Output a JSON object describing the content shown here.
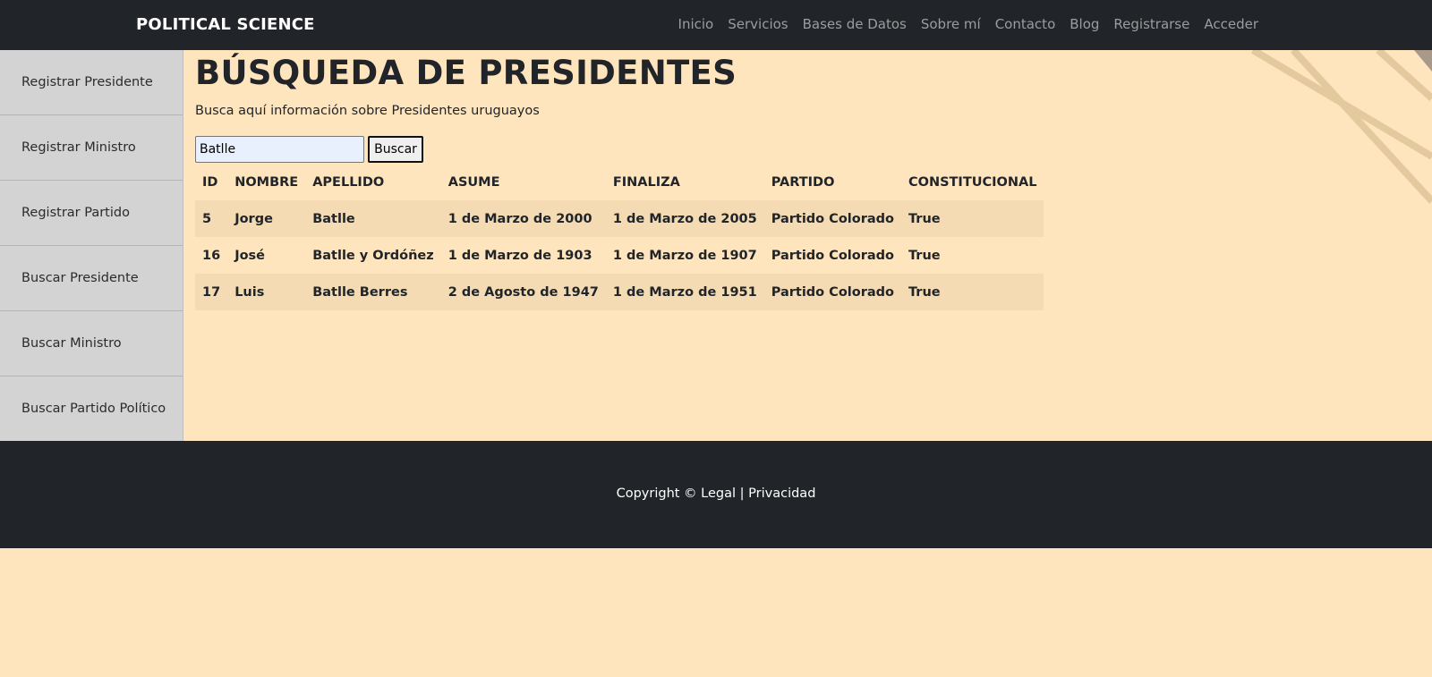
{
  "navbar": {
    "brand": "POLITICAL SCIENCE",
    "links": [
      "Inicio",
      "Servicios",
      "Bases de Datos",
      "Sobre mí",
      "Contacto",
      "Blog",
      "Registrarse",
      "Acceder"
    ]
  },
  "sidebar": {
    "items": [
      {
        "label": "Registrar Presidente"
      },
      {
        "label": "Registrar Ministro"
      },
      {
        "label": "Registrar Partido"
      },
      {
        "label": "Buscar Presidente"
      },
      {
        "label": "Buscar Ministro"
      },
      {
        "label": "Buscar Partido Político"
      }
    ]
  },
  "main": {
    "title": "BÚSQUEDA DE PRESIDENTES",
    "subtitle": "Busca aquí información sobre Presidentes uruguayos",
    "search": {
      "value": "Batlle",
      "button_label": "Buscar"
    },
    "table": {
      "headers": [
        "ID",
        "NOMBRE",
        "APELLIDO",
        "ASUME",
        "FINALIZA",
        "PARTIDO",
        "CONSTITUCIONAL"
      ],
      "rows": [
        [
          "5",
          "Jorge",
          "Batlle",
          "1 de Marzo de 2000",
          "1 de Marzo de 2005",
          "Partido Colorado",
          "True"
        ],
        [
          "16",
          "José",
          "Batlle y Ordóñez",
          "1 de Marzo de 1903",
          "1 de Marzo de 1907",
          "Partido Colorado",
          "True"
        ],
        [
          "17",
          "Luis",
          "Batlle Berres",
          "2 de Agosto de 1947",
          "1 de Marzo de 1951",
          "Partido Colorado",
          "True"
        ]
      ]
    }
  },
  "footer": {
    "copyright": "Copyright ©",
    "legal": "Legal",
    "separator": "|",
    "privacy": "Privacidad"
  },
  "colors": {
    "background": "#ffe5bd",
    "navbar": "#212529",
    "sidebar": "#d3d3d3",
    "table_stripe": "#f4dbb3",
    "decor_line": "#e2c79c"
  }
}
